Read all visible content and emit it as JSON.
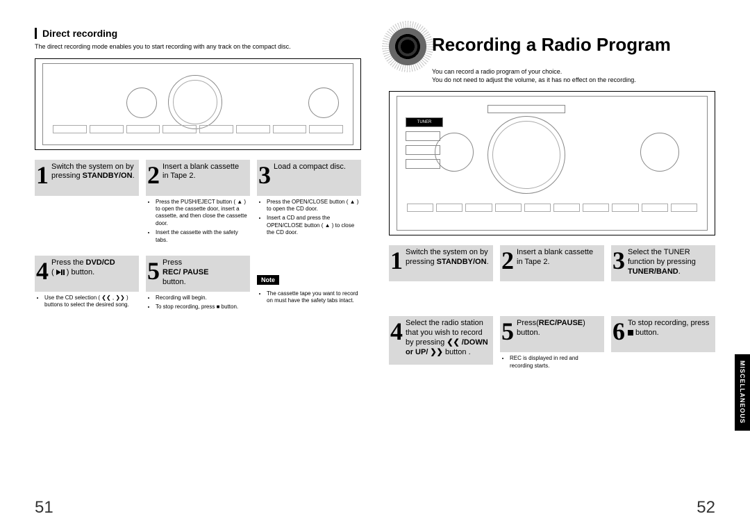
{
  "left": {
    "section_heading": "Direct recording",
    "section_desc": "The direct recording mode enables you to start recording with any track on the compact disc.",
    "steps": [
      {
        "num": "1",
        "text_pre": "Switch the system on by pressing ",
        "text_bold": "STANDBY/ON",
        "text_post": ".",
        "details": []
      },
      {
        "num": "2",
        "text_pre": "Insert a blank cassette in Tape 2.",
        "text_bold": "",
        "text_post": "",
        "details": [
          "Press the PUSH/EJECT button ( ▲ ) to open the cassette door, insert a cassette, and then close the cassette door.",
          "Insert the cassette with the safety tabs."
        ]
      },
      {
        "num": "3",
        "text_pre": "Load a compact disc.",
        "text_bold": "",
        "text_post": "",
        "details": [
          "Press the OPEN/CLOSE button ( ▲ ) to open the CD door.",
          "Insert a CD and press the OPEN/CLOSE button ( ▲ ) to close the CD door."
        ]
      },
      {
        "num": "4",
        "text_pre": "Press the ",
        "text_bold": "DVD/CD",
        "text_post": " ( ▶/❚❚ ) button.",
        "details": [
          "Use the CD selection ( ❮❮ , ❯❯ ) buttons to select the desired song."
        ]
      },
      {
        "num": "5",
        "text_pre": "Press ",
        "text_bold": "REC/ PAUSE",
        "text_post": " button.",
        "details": [
          "Recording will begin.",
          "To stop recording, press ■ button."
        ]
      }
    ],
    "note_label": "Note",
    "note_text": "The cassette tape you want to record on must have the safety tabs intact.",
    "page_number": "51"
  },
  "right": {
    "title": "Recording a Radio Program",
    "intro1": "You can record a radio program of your choice.",
    "intro2": "You do not need to adjust the volume, as it has no effect on the recording.",
    "device_labels": {
      "tuner": "TUNER"
    },
    "steps": [
      {
        "num": "1",
        "text_pre": "Switch the system on by pressing ",
        "text_bold": "STANDBY/ON",
        "text_post": ".",
        "details": []
      },
      {
        "num": "2",
        "text_pre": "Insert a blank cassette in Tape 2.",
        "text_bold": "",
        "text_post": "",
        "details": []
      },
      {
        "num": "3",
        "text_pre": "Select the TUNER function by pressing ",
        "text_bold": "TUNER/BAND",
        "text_post": ".",
        "details": []
      },
      {
        "num": "4",
        "text_pre": "Select the radio station that you wish to record by pressing ",
        "text_bold": "❮❮ /DOWN or UP/ ❯❯",
        "text_post": " button .",
        "details": []
      },
      {
        "num": "5",
        "text_pre": "Press(",
        "text_bold": "REC/PAUSE",
        "text_post": ") button.",
        "details": [
          "REC is displayed in red and recording starts."
        ]
      },
      {
        "num": "6",
        "text_pre": "To stop recording, press ■ button.",
        "text_bold": "",
        "text_post": "",
        "details": []
      }
    ],
    "side_tab": "MISCELLANEOUS",
    "page_number": "52"
  }
}
